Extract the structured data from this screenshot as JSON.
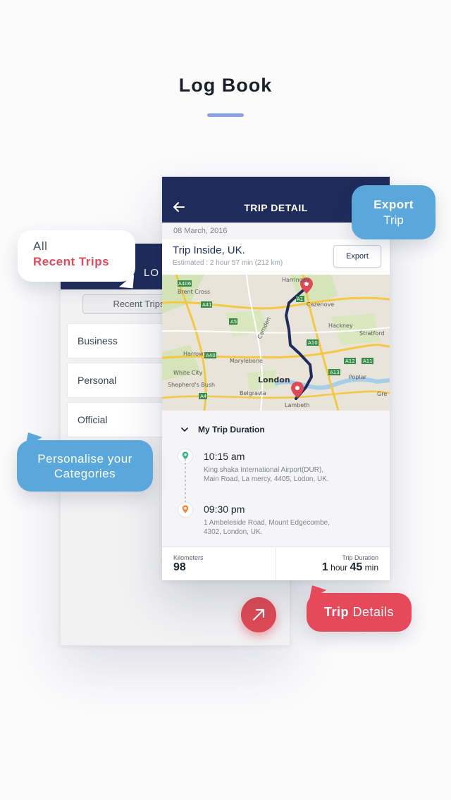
{
  "page": {
    "title": "Log Book"
  },
  "back_screen": {
    "header_title": "LO",
    "tab_label": "Recent Trips",
    "categories": [
      "Business",
      "Personal",
      "Official"
    ]
  },
  "trip_detail": {
    "header_title": "TRIP DETAIL",
    "date": "08 March, 2016",
    "trip_name": "Trip Inside, UK.",
    "estimated": "Estimated : 2 hour 57 min (212 km)",
    "export_label": "Export",
    "map": {
      "labels": [
        "Brent Cross",
        "Harringay",
        "Cazenove",
        "Camden",
        "Hackney",
        "Stratford",
        "Harrow",
        "Marylebone",
        "White City",
        "Shepherd's Bush",
        "London",
        "Belgravia",
        "Lambeth",
        "Poplar",
        "Gre",
        "A406",
        "A41",
        "A5",
        "A10",
        "A11",
        "A13",
        "A40",
        "A1",
        "A12",
        "A4"
      ]
    },
    "duration_heading": "My Trip Duration",
    "stops": [
      {
        "time": "10:15 am",
        "address_line1": "King shaka International Airport(DUR),",
        "address_line2": "Main Road, La mercy, 4405, Lodon, UK."
      },
      {
        "time": "09:30 pm",
        "address_line1": "1 Ambeleside Road, Mount Edgecombe,",
        "address_line2": "4302, London, UK."
      }
    ],
    "stats": {
      "km_label": "Kilometers",
      "km_value": "98",
      "duration_label": "Trip Duration",
      "duration_hours": "1",
      "duration_hour_unit": "hour",
      "duration_minutes": "45",
      "duration_min_unit": "min"
    }
  },
  "callouts": {
    "all_line1": "All",
    "all_line2": "Recent Trips",
    "export_line1": "Export",
    "export_line2": "Trip",
    "personalise_line1": "Personalise your",
    "personalise_line2": "Categories",
    "trip_bold": "Trip",
    "trip_rest": "Details"
  },
  "colors": {
    "navy": "#1f2c5b",
    "accent_red": "#e04a55",
    "accent_blue": "#5aa7dc",
    "underline": "#8aa3e6"
  },
  "icons": {
    "back": "arrow-left-icon",
    "fab": "arrow-up-right-icon",
    "chevron": "chevron-down-icon",
    "start_pin": "location-pin-green-icon",
    "end_pin": "location-pin-orange-icon"
  }
}
